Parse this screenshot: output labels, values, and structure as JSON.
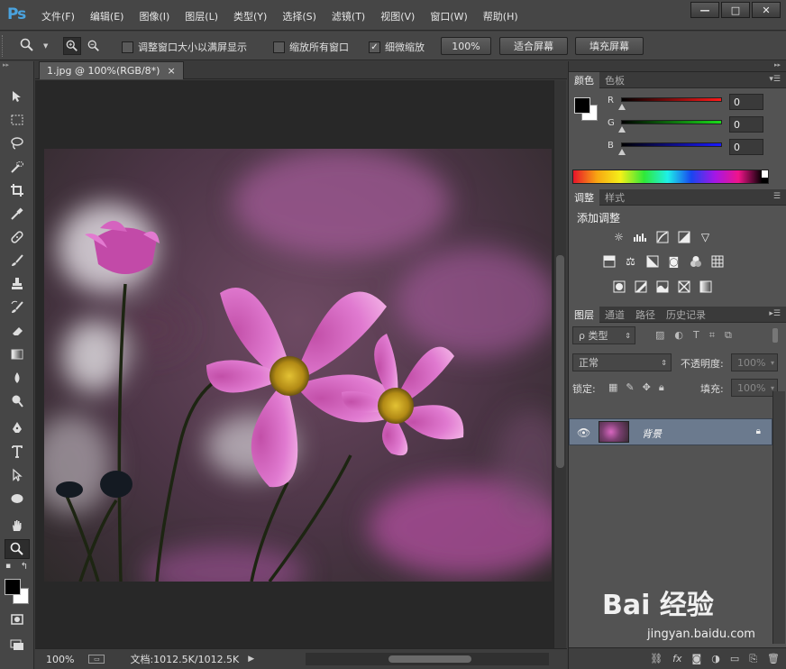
{
  "app": {
    "logo": "Ps"
  },
  "menu": [
    "文件(F)",
    "编辑(E)",
    "图像(I)",
    "图层(L)",
    "类型(Y)",
    "选择(S)",
    "滤镜(T)",
    "视图(V)",
    "窗口(W)",
    "帮助(H)"
  ],
  "window_controls": {
    "minimize": "—",
    "restore": "□",
    "close": "✕"
  },
  "options": {
    "resize_windows": {
      "label": "调整窗口大小以满屏显示",
      "checked": false
    },
    "zoom_all": {
      "label": "缩放所有窗口",
      "checked": false
    },
    "scrubby": {
      "label": "细微缩放",
      "checked": true
    },
    "btn_100": "100%",
    "btn_fit": "适合屏幕",
    "btn_fill": "填充屏幕"
  },
  "document": {
    "tab_title": "1.jpg @ 100%(RGB/8*)",
    "tab_close": "×"
  },
  "status": {
    "zoom": "100%",
    "doc_info": "文档:1012.5K/1012.5K",
    "arrow": "▶"
  },
  "color_panel": {
    "tabs": [
      "颜色",
      "色板"
    ],
    "sliders": [
      {
        "label": "R",
        "value": "0",
        "color": "#e01b1b"
      },
      {
        "label": "G",
        "value": "0",
        "color": "#1bd21b"
      },
      {
        "label": "B",
        "value": "0",
        "color": "#1b1bdc"
      }
    ]
  },
  "adjust_panel": {
    "tabs": [
      "调整",
      "样式"
    ],
    "title": "添加调整"
  },
  "layers_panel": {
    "tabs": [
      "图层",
      "通道",
      "路径",
      "历史记录"
    ],
    "filter_kind": "ρ 类型",
    "blend_mode": "正常",
    "opacity_label": "不透明度:",
    "opacity_value": "100%",
    "lock_label": "锁定:",
    "fill_label": "填充:",
    "fill_value": "100%",
    "layer_name": "背景"
  },
  "watermark": {
    "logo": "Bai 经验",
    "url": "jingyan.baidu.com"
  }
}
